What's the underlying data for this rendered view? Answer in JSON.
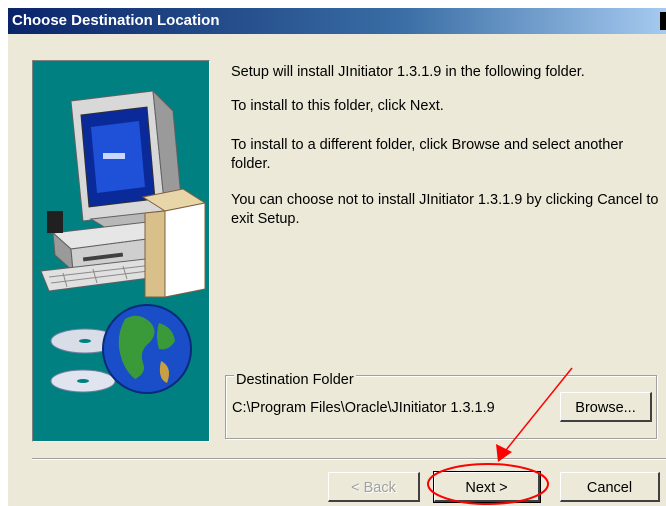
{
  "window": {
    "title": "Choose Destination Location"
  },
  "messages": [
    "Setup will install JInitiator 1.3.1.9 in the following folder.",
    "To install to this folder, click Next.",
    "To install to a different folder, click Browse and select another folder.",
    "You can choose not to install JInitiator 1.3.1.9 by clicking Cancel to exit Setup."
  ],
  "destination": {
    "group_label": "Destination Folder",
    "path": "C:\\Program Files\\Oracle\\JInitiator 1.3.1.9",
    "browse_label": "Browse..."
  },
  "buttons": {
    "back": "< Back",
    "next": "Next >",
    "cancel": "Cancel"
  },
  "annotation": {
    "color": "#ff0000"
  }
}
